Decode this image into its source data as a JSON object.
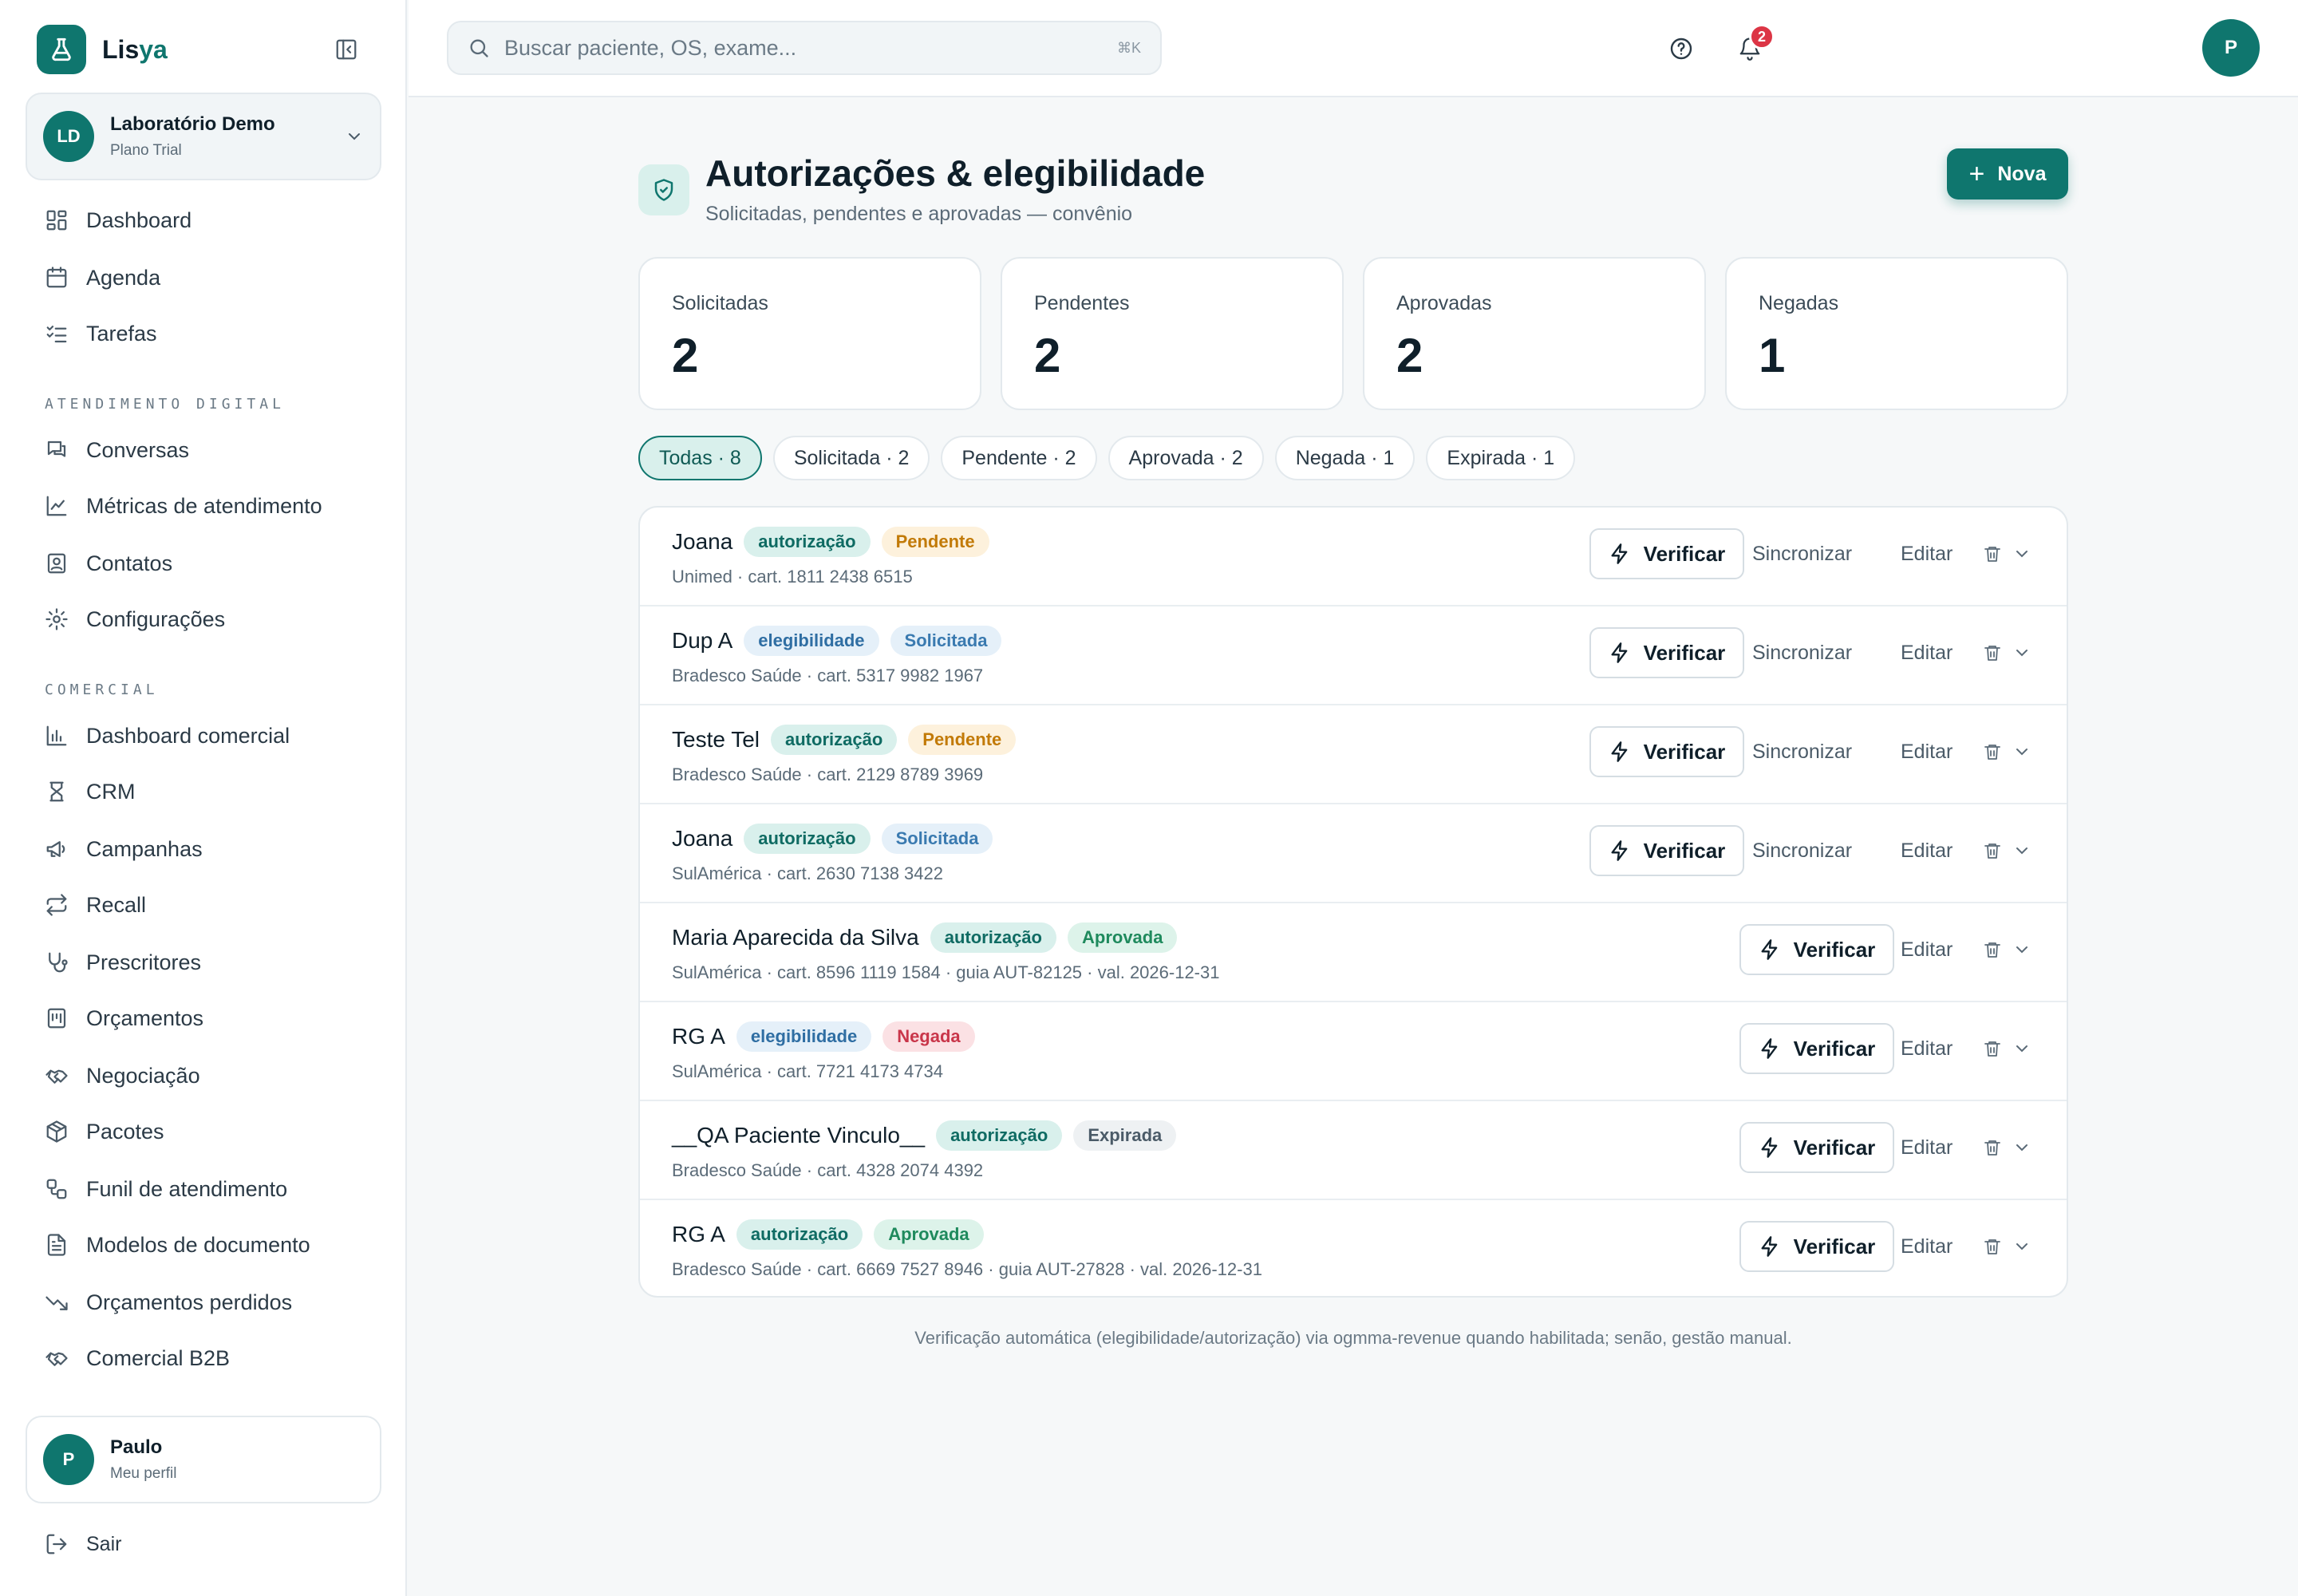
{
  "brand": {
    "part1": "Lis",
    "part2": "ya"
  },
  "org": {
    "initials": "LD",
    "name": "Laboratório Demo",
    "plan": "Plano Trial"
  },
  "nav": {
    "main": [
      {
        "label": "Dashboard"
      },
      {
        "label": "Agenda"
      },
      {
        "label": "Tarefas"
      }
    ],
    "section1": "ATENDIMENTO DIGITAL",
    "digital": [
      {
        "label": "Conversas"
      },
      {
        "label": "Métricas de atendimento"
      },
      {
        "label": "Contatos"
      },
      {
        "label": "Configurações"
      }
    ],
    "section2": "COMERCIAL",
    "commercial": [
      {
        "label": "Dashboard comercial"
      },
      {
        "label": "CRM"
      },
      {
        "label": "Campanhas"
      },
      {
        "label": "Recall"
      },
      {
        "label": "Prescritores"
      },
      {
        "label": "Orçamentos"
      },
      {
        "label": "Negociação"
      },
      {
        "label": "Pacotes"
      },
      {
        "label": "Funil de atendimento"
      },
      {
        "label": "Modelos de documento"
      },
      {
        "label": "Orçamentos perdidos"
      },
      {
        "label": "Comercial B2B"
      }
    ]
  },
  "profile": {
    "initial": "P",
    "name": "Paulo",
    "link": "Meu perfil"
  },
  "logout": "Sair",
  "search": {
    "placeholder": "Buscar paciente, OS, exame...",
    "shortcut": "⌘K"
  },
  "notifications": {
    "count": "2"
  },
  "user": {
    "initial": "P"
  },
  "page": {
    "title": "Autorizações & elegibilidade",
    "subtitle": "Solicitadas, pendentes e aprovadas — convênio",
    "new_button": "Nova"
  },
  "stats": [
    {
      "label": "Solicitadas",
      "value": "2"
    },
    {
      "label": "Pendentes",
      "value": "2"
    },
    {
      "label": "Aprovadas",
      "value": "2"
    },
    {
      "label": "Negadas",
      "value": "1"
    }
  ],
  "filters": [
    {
      "label": "Todas · 8",
      "active": true
    },
    {
      "label": "Solicitada · 2"
    },
    {
      "label": "Pendente · 2"
    },
    {
      "label": "Aprovada · 2"
    },
    {
      "label": "Negada · 1"
    },
    {
      "label": "Expirada · 1"
    }
  ],
  "actions": {
    "verify": "Verificar",
    "sync": "Sincronizar",
    "edit": "Editar"
  },
  "rows": [
    {
      "name": "Joana",
      "type": "autorização",
      "status": "Pendente",
      "details": "Unimed · cart. 1811 2438 6515",
      "sync": true
    },
    {
      "name": "Dup A",
      "type": "elegibilidade",
      "status": "Solicitada",
      "details": "Bradesco Saúde · cart. 5317 9982 1967",
      "sync": true
    },
    {
      "name": "Teste Tel",
      "type": "autorização",
      "status": "Pendente",
      "details": "Bradesco Saúde · cart. 2129 8789 3969",
      "sync": true
    },
    {
      "name": "Joana",
      "type": "autorização",
      "status": "Solicitada",
      "details": "SulAmérica · cart. 2630 7138 3422",
      "sync": true
    },
    {
      "name": "Maria Aparecida da Silva",
      "type": "autorização",
      "status": "Aprovada",
      "details": "SulAmérica · cart. 8596 1119 1584 · guia AUT-82125 · val. 2026-12-31",
      "sync": false
    },
    {
      "name": "RG A",
      "type": "elegibilidade",
      "status": "Negada",
      "details": "SulAmérica · cart. 7721 4173 4734",
      "sync": false
    },
    {
      "name": "__QA Paciente Vinculo__",
      "type": "autorização",
      "status": "Expirada",
      "details": "Bradesco Saúde · cart. 4328 2074 4392",
      "sync": false
    },
    {
      "name": "RG A",
      "type": "autorização",
      "status": "Aprovada",
      "details": "Bradesco Saúde · cart. 6669 7527 8946 · guia AUT-27828 · val. 2026-12-31",
      "sync": false
    }
  ],
  "footnote": "Verificação automática (elegibilidade/autorização) via ogmma-revenue quando habilitada; senão, gestão manual."
}
